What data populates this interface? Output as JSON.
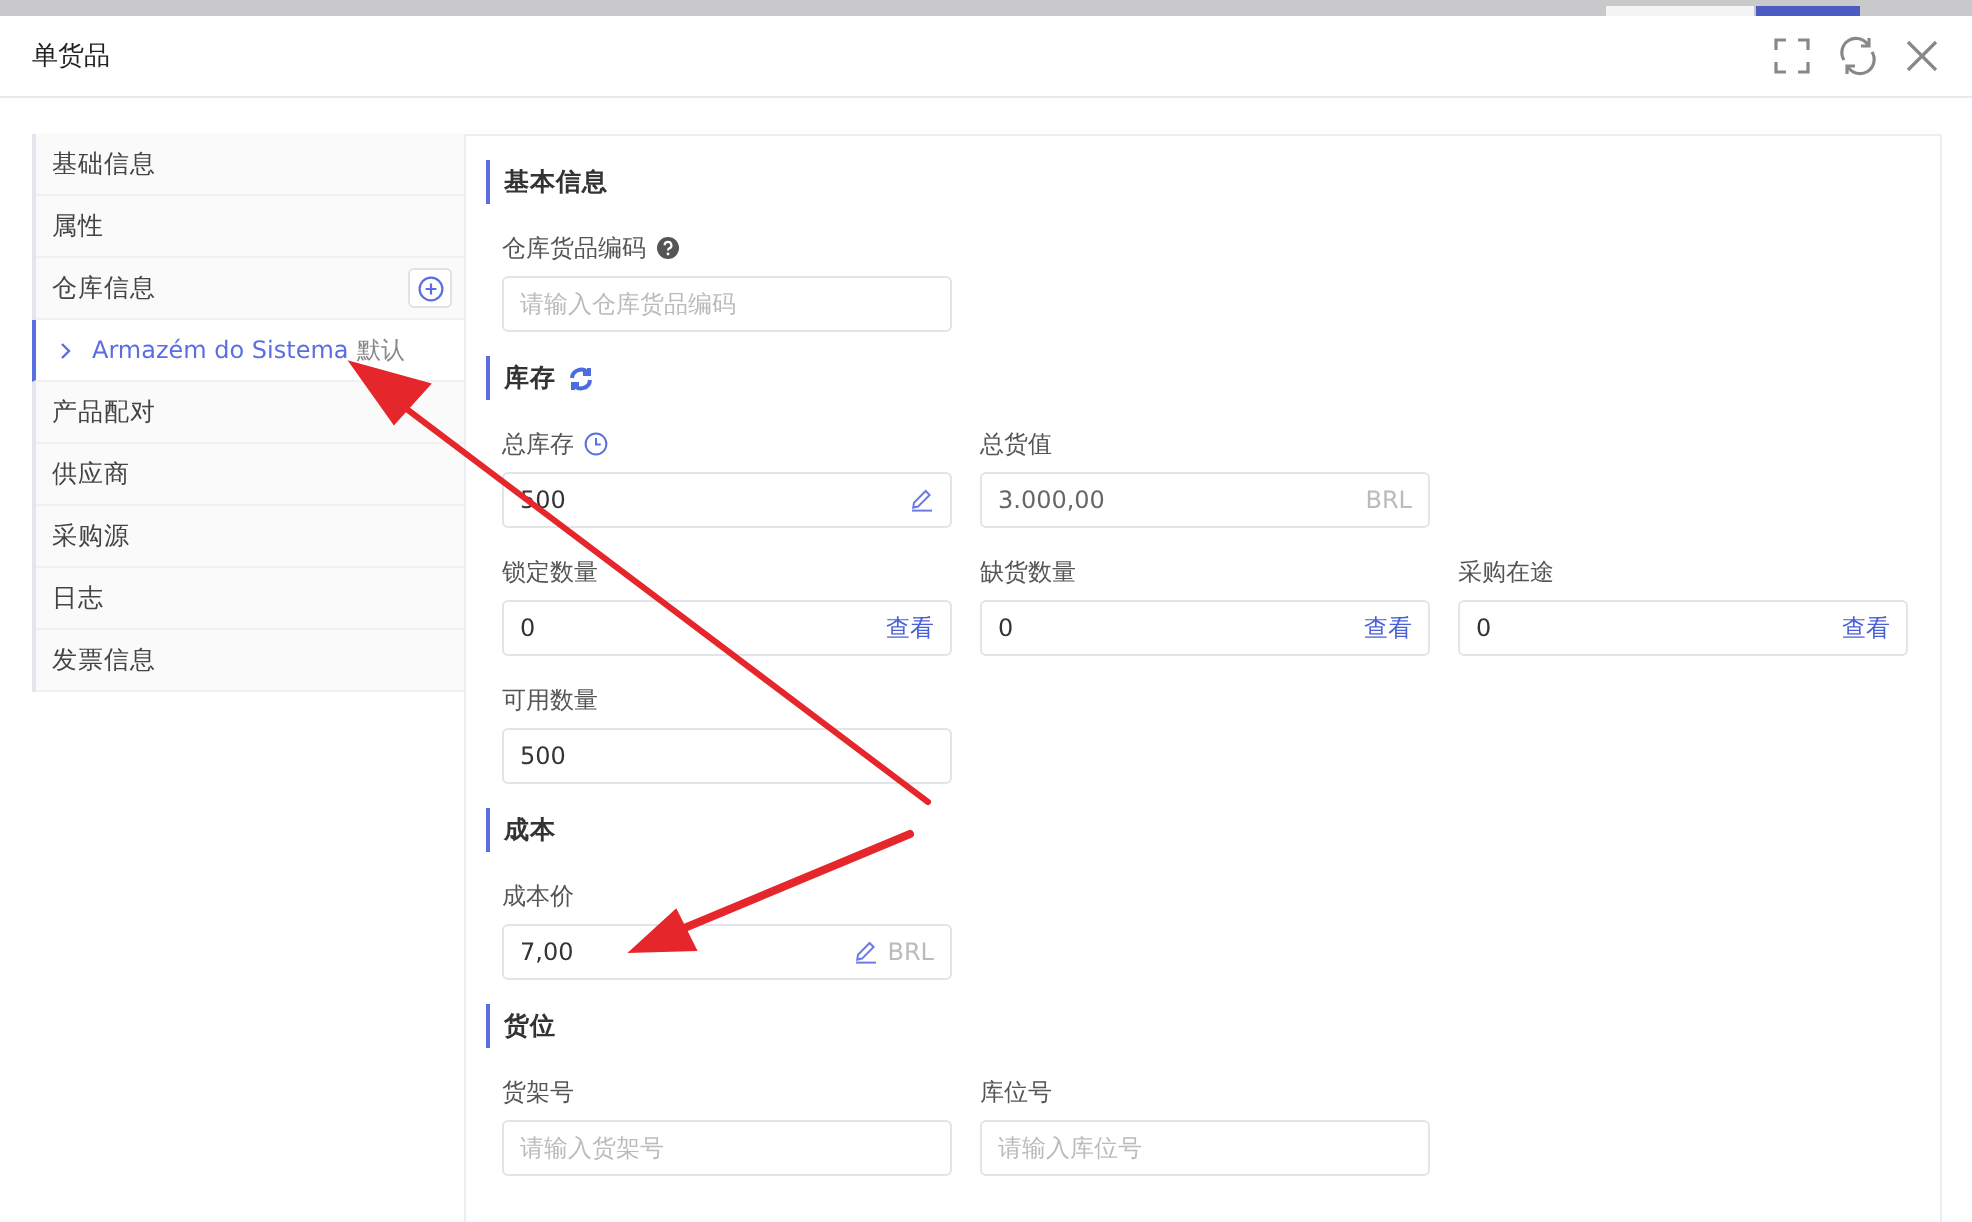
{
  "window": {
    "title": "单货品"
  },
  "sidebar": {
    "items": [
      {
        "kind": "item",
        "label": "基础信息",
        "selected": false
      },
      {
        "kind": "item",
        "label": "属性",
        "selected": false
      },
      {
        "kind": "item",
        "label": "仓库信息",
        "selected": false,
        "add_button": true
      },
      {
        "kind": "warehouse",
        "label": "Armazém do Sistema",
        "tag": "默认",
        "selected": true
      },
      {
        "kind": "item",
        "label": "产品配对",
        "selected": false
      },
      {
        "kind": "item",
        "label": "供应商",
        "selected": false
      },
      {
        "kind": "item",
        "label": "采购源",
        "selected": false
      },
      {
        "kind": "item",
        "label": "日志",
        "selected": false
      },
      {
        "kind": "item",
        "label": "发票信息",
        "selected": false
      }
    ]
  },
  "sections": [
    {
      "title": "基本信息",
      "refresh": false,
      "rows": [
        [
          {
            "label": "仓库货品编码",
            "help": true,
            "placeholder": "请输入仓库货品编码"
          }
        ]
      ]
    },
    {
      "title": "库存",
      "refresh": true,
      "rows": [
        [
          {
            "label": "总库存",
            "history": true,
            "value": "500",
            "editable": true
          },
          {
            "label": "总货值",
            "value": "3.000,00",
            "disabled": true,
            "suffix": "BRL"
          }
        ],
        [
          {
            "label": "锁定数量",
            "value": "0",
            "link": "查看"
          },
          {
            "label": "缺货数量",
            "value": "0",
            "link": "查看"
          },
          {
            "label": "采购在途",
            "value": "0",
            "link": "查看"
          }
        ],
        [
          {
            "label": "可用数量",
            "value": "500"
          }
        ]
      ]
    },
    {
      "title": "成本",
      "refresh": false,
      "rows": [
        [
          {
            "label": "成本价",
            "value": "7,00",
            "editable": true,
            "suffix": "BRL"
          }
        ]
      ]
    },
    {
      "title": "货位",
      "refresh": false,
      "rows": [
        [
          {
            "label": "货架号",
            "placeholder": "请输入货架号"
          },
          {
            "label": "库位号",
            "placeholder": "请输入库位号"
          }
        ]
      ]
    }
  ]
}
